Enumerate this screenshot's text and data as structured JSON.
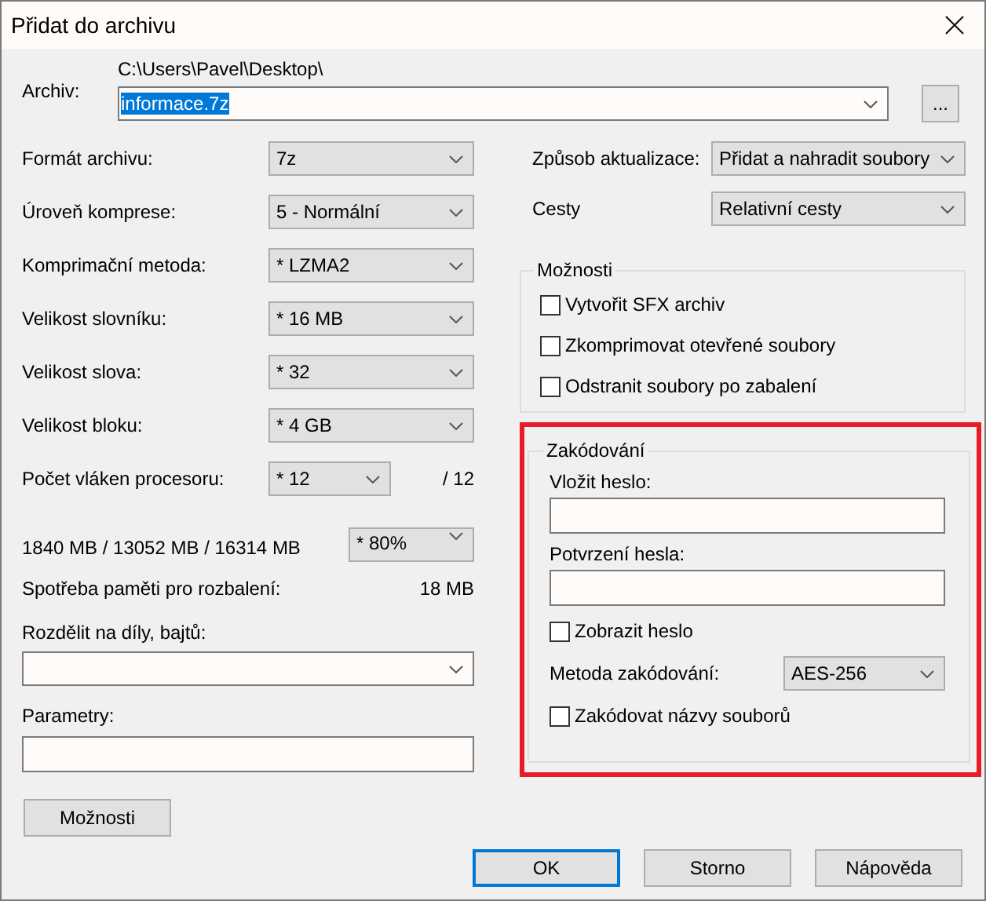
{
  "window": {
    "title": "Přidat do archivu"
  },
  "archive": {
    "label": "Archiv:",
    "folder": "C:\\Users\\Pavel\\Desktop\\",
    "value": "informace.7z",
    "text_selected": true,
    "browse": "..."
  },
  "settings": [
    {
      "label": "Formát archivu:",
      "value": "7z",
      "kind": "combo"
    },
    {
      "label": "Úroveň komprese:",
      "value": "5 - Normální",
      "kind": "combo"
    },
    {
      "label": "Komprimační metoda:",
      "value": "* LZMA2",
      "kind": "combo"
    },
    {
      "label": "Velikost slovníku:",
      "value": "* 16 MB",
      "kind": "combo"
    },
    {
      "label": "Velikost slova:",
      "value": "* 32",
      "kind": "combo"
    },
    {
      "label": "Velikost bloku:",
      "value": "* 4 GB",
      "kind": "combo"
    },
    {
      "label": "Počet vláken procesoru:",
      "value": "* 12",
      "kind": "short-combo",
      "total": "/ 12"
    }
  ],
  "memory": {
    "usage": "1840 MB / 13052 MB / 16314 MB",
    "limit": "* 80%",
    "decompress_label": "Spotřeba paměti pro rozbalení:",
    "decompress_value": "18 MB"
  },
  "split": {
    "label": "Rozdělit na díly, bajtů:"
  },
  "parameters": {
    "label": "Parametry:"
  },
  "options_button": "Možnosti",
  "update": {
    "label": "Způsob aktualizace:",
    "value": "Přidat a nahradit soubory"
  },
  "paths": {
    "label": "Cesty",
    "value": "Relativní cesty"
  },
  "options": {
    "title": "Možnosti",
    "checkboxes": [
      {
        "label": "Vytvořit SFX archiv",
        "checked": false
      },
      {
        "label": "Zkomprimovat otevřené soubory",
        "checked": false
      },
      {
        "label": "Odstranit soubory po zabalení",
        "checked": false
      }
    ]
  },
  "encryption": {
    "title": "Zakódování",
    "highlighted": true,
    "password_label": "Vložit heslo:",
    "confirm_label": "Potvrzení hesla:",
    "show_password": {
      "label": "Zobrazit heslo",
      "checked": false
    },
    "method_label": "Metoda zakódování:",
    "method": "AES-256",
    "encrypt_names": {
      "label": "Zakódovat názvy souborů",
      "checked": false
    }
  },
  "buttons": [
    {
      "label": "OK",
      "default": true
    },
    {
      "label": "Storno",
      "default": false
    },
    {
      "label": "Nápověda",
      "default": false
    }
  ]
}
